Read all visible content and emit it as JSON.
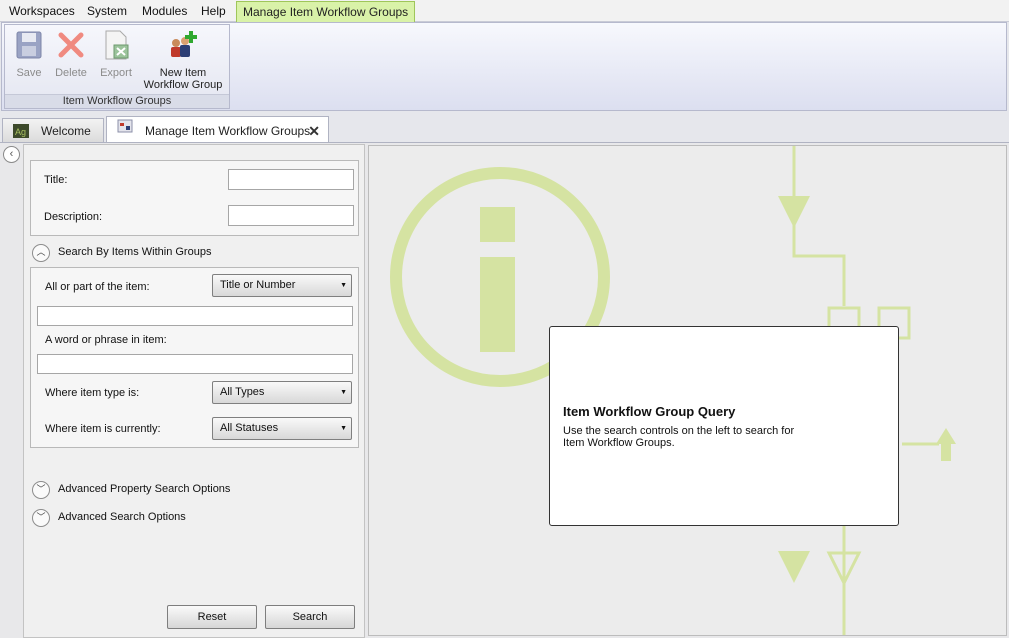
{
  "menubar": {
    "items": [
      "Workspaces",
      "System",
      "Modules",
      "Help"
    ],
    "active_tab": "Manage Item Workflow Groups"
  },
  "ribbon": {
    "group_label": "Item Workflow Groups",
    "buttons": {
      "save": "Save",
      "delete": "Delete",
      "export": "Export",
      "new_line1": "New Item",
      "new_line2": "Workflow Group"
    }
  },
  "tabs": [
    {
      "label": "Welcome",
      "icon": "app-logo-icon"
    },
    {
      "label": "Manage Item Workflow Groups",
      "icon": "workflow-group-icon",
      "active": true
    }
  ],
  "search": {
    "title_label": "Title:",
    "title_value": "",
    "description_label": "Description:",
    "description_value": "",
    "items_section_label": "Search By Items Within Groups",
    "item_part_label": "All or part of the item:",
    "item_part_select": "Title or Number",
    "item_part_value": "",
    "phrase_label": "A word or phrase in item:",
    "phrase_value": "",
    "type_label": "Where item type is:",
    "type_select": "All Types",
    "status_label": "Where item is currently:",
    "status_select": "All Statuses",
    "adv_property_label": "Advanced Property Search Options",
    "adv_search_label": "Advanced Search Options",
    "reset_label": "Reset",
    "search_label": "Search"
  },
  "info": {
    "title": "Item Workflow Group Query",
    "text": "Use the search controls on the left to search for Item Workflow Groups."
  },
  "colors": {
    "accent_green": "#d9f2a8",
    "watermark_green": "#d7e4a6"
  }
}
